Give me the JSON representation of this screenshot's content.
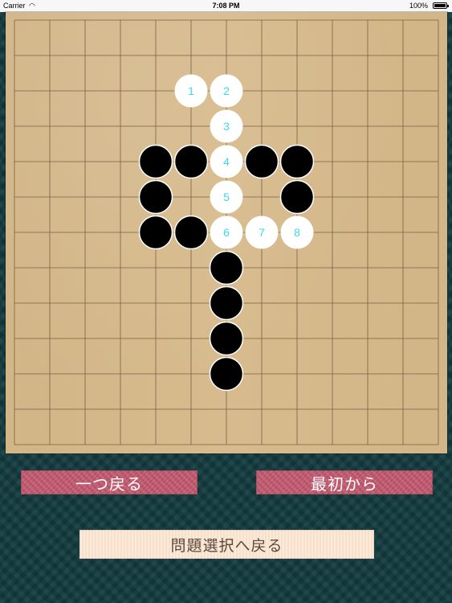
{
  "status_bar": {
    "carrier": "Carrier",
    "time": "7:08 PM",
    "battery": "100%"
  },
  "board": {
    "lines": 13,
    "black_stones": [
      [
        4,
        4
      ],
      [
        5,
        4
      ],
      [
        7,
        4
      ],
      [
        8,
        4
      ],
      [
        4,
        5
      ],
      [
        8,
        5
      ],
      [
        4,
        6
      ],
      [
        5,
        6
      ],
      [
        6,
        7
      ],
      [
        6,
        8
      ],
      [
        6,
        9
      ],
      [
        6,
        10
      ]
    ],
    "white_stones": [
      {
        "col": 5,
        "row": 2,
        "label": "1"
      },
      {
        "col": 6,
        "row": 2,
        "label": "2"
      },
      {
        "col": 6,
        "row": 3,
        "label": "3"
      },
      {
        "col": 6,
        "row": 4,
        "label": "4"
      },
      {
        "col": 6,
        "row": 5,
        "label": "5"
      },
      {
        "col": 6,
        "row": 6,
        "label": "6"
      },
      {
        "col": 7,
        "row": 6,
        "label": "7"
      },
      {
        "col": 8,
        "row": 6,
        "label": "8"
      }
    ],
    "colors": {
      "wood": "#d6b98a",
      "grid": "#7a6040",
      "black_stone": "#000000",
      "white_stone": "#ffffff",
      "number": "#3fd8e8"
    }
  },
  "buttons": {
    "undo": "一つ戻る",
    "restart": "最初から",
    "back_to_select": "問題選択へ戻る"
  }
}
